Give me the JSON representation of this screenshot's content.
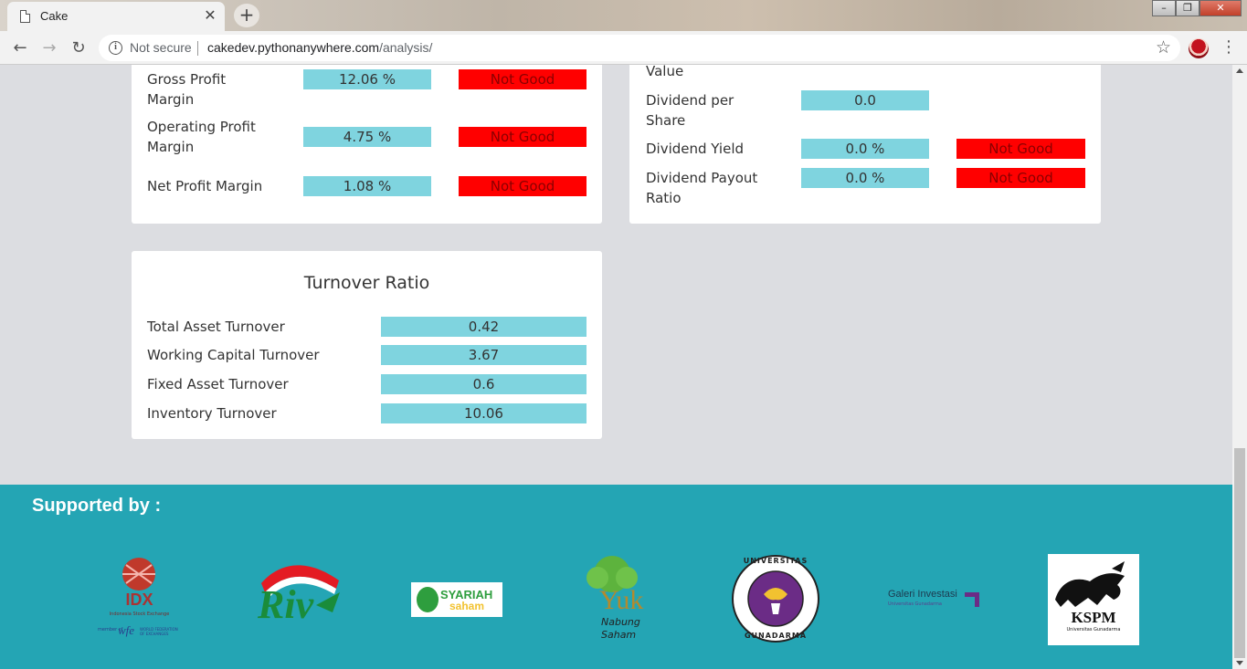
{
  "browser": {
    "tab_title": "Cake",
    "new_tab_symbol": "+",
    "close_symbol": "✕",
    "security_label": "Not secure",
    "url_host": "cakedev.pythonanywhere.com",
    "url_path": "/analysis/"
  },
  "profitability": {
    "rows": [
      {
        "label_line1": "Gross Profit",
        "label_line2": "Margin",
        "value": "12.06 %",
        "status": "Not Good"
      },
      {
        "label_line1": "Operating Profit",
        "label_line2": "Margin",
        "value": "4.75 %",
        "status": "Not Good"
      },
      {
        "label": "Net Profit Margin",
        "value": "1.08 %",
        "status": "Not Good"
      }
    ]
  },
  "market": {
    "partial_label": "Value",
    "rows": [
      {
        "label_line1": "Dividend per",
        "label_line2": "Share",
        "value": "0.0"
      },
      {
        "label": "Dividend Yield",
        "value": "0.0 %",
        "status": "Not Good"
      },
      {
        "label_line1": "Dividend Payout",
        "label_line2": "Ratio",
        "value": "0.0 %",
        "status": "Not Good"
      }
    ]
  },
  "turnover": {
    "title": "Turnover Ratio",
    "rows": [
      {
        "label": "Total Asset Turnover",
        "value": "0.42"
      },
      {
        "label": "Working Capital Turnover",
        "value": "3.67"
      },
      {
        "label": "Fixed Asset Turnover",
        "value": "0.6"
      },
      {
        "label": "Inventory Turnover",
        "value": "10.06"
      }
    ]
  },
  "footer": {
    "heading": "Supported by :",
    "logos": {
      "idx": {
        "name": "IDX",
        "sub": "Indonesia Stock Exchange",
        "member": "member of",
        "wfe": "wfe",
        "wfe_sub": "WORLD FEDERATION OF EXCHANGES"
      },
      "riv": {
        "name": "Riv"
      },
      "syariah": {
        "line1": "SYARIAH",
        "line2": "saham"
      },
      "yuk": {
        "name": "Yuk",
        "line1": "Nabung",
        "line2": "Saham"
      },
      "gunadarma": {
        "top": "UNIVERSITAS",
        "bottom": "GUNADARMA"
      },
      "galeri": {
        "name": "Galeri Investasi",
        "sub": "Universitas Gunadarma"
      },
      "kspm": {
        "name": "KSPM",
        "sub": "Universitas Gunadarma"
      }
    }
  },
  "colors": {
    "value_bg": "#7fd4df",
    "bad_bg": "#ff0000",
    "footer_bg": "#24a5b4",
    "page_bg": "#dcdde1"
  }
}
